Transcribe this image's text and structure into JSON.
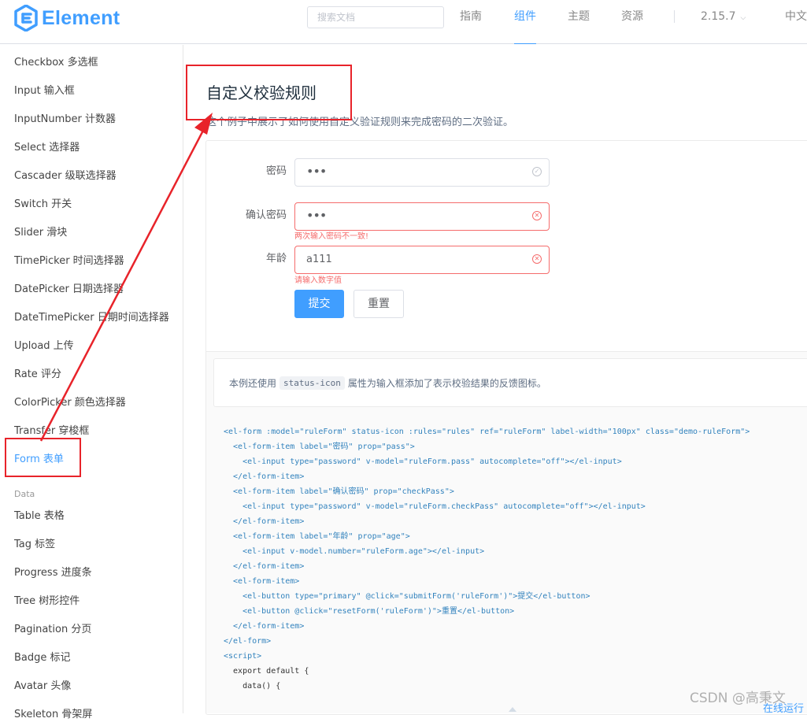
{
  "header": {
    "logo_text": "Element",
    "search_placeholder": "搜索文档",
    "nav": [
      "指南",
      "组件",
      "主题",
      "资源"
    ],
    "active_nav": "组件",
    "version": "2.15.7",
    "language": "中文"
  },
  "sidebar": {
    "items_before": [
      "Checkbox 多选框",
      "Input 输入框",
      "InputNumber 计数器",
      "Select 选择器",
      "Cascader 级联选择器",
      "Switch 开关",
      "Slider 滑块",
      "TimePicker 时间选择器",
      "DatePicker 日期选择器",
      "DateTimePicker 日期时间选择器",
      "Upload 上传",
      "Rate 评分",
      "ColorPicker 颜色选择器",
      "Transfer 穿梭框",
      "Form 表单"
    ],
    "group_data": "Data",
    "items_after": [
      "Table 表格",
      "Tag 标签",
      "Progress 进度条",
      "Tree 树形控件",
      "Pagination 分页",
      "Badge 标记",
      "Avatar 头像",
      "Skeleton 骨架屏"
    ]
  },
  "main": {
    "title": "自定义校验规则",
    "description": "这个例子中展示了如何使用自定义验证规则来完成密码的二次验证。",
    "form": {
      "password_label": "密码",
      "password_value": "•••",
      "confirm_label": "确认密码",
      "confirm_value": "•••",
      "confirm_error": "两次输入密码不一致!",
      "age_label": "年龄",
      "age_value": "a111",
      "age_error": "请输入数字值",
      "submit_label": "提交",
      "reset_label": "重置"
    },
    "note_prefix": "本例还使用",
    "note_code": "status-icon",
    "note_suffix": "属性为输入框添加了表示校验结果的反馈图标。",
    "code_lines": [
      "<el-form :model=\"ruleForm\" status-icon :rules=\"rules\" ref=\"ruleForm\" label-width=\"100px\" class=\"demo-ruleForm\">",
      "  <el-form-item label=\"密码\" prop=\"pass\">",
      "    <el-input type=\"password\" v-model=\"ruleForm.pass\" autocomplete=\"off\"></el-input>",
      "  </el-form-item>",
      "  <el-form-item label=\"确认密码\" prop=\"checkPass\">",
      "    <el-input type=\"password\" v-model=\"ruleForm.checkPass\" autocomplete=\"off\"></el-input>",
      "  </el-form-item>",
      "  <el-form-item label=\"年龄\" prop=\"age\">",
      "    <el-input v-model.number=\"ruleForm.age\"></el-input>",
      "  </el-form-item>",
      "  <el-form-item>",
      "    <el-button type=\"primary\" @click=\"submitForm('ruleForm')\">提交</el-button>",
      "    <el-button @click=\"resetForm('ruleForm')\">重置</el-button>",
      "  </el-form-item>",
      "</el-form>",
      "<script>",
      "  export default {",
      "    data() {"
    ],
    "run_link": "在线运行"
  },
  "watermark": "CSDN @高秉文",
  "colors": {
    "accent": "#409eff",
    "error": "#f56c6c",
    "annotation": "#e8232a"
  }
}
